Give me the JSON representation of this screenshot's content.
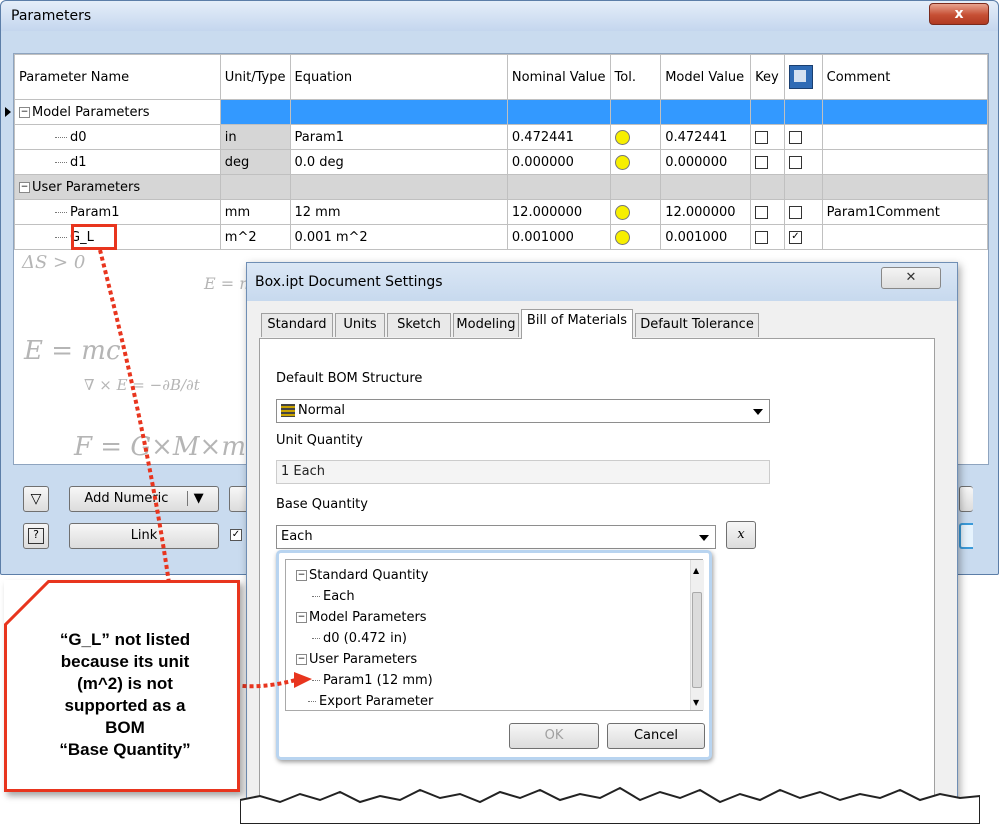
{
  "parameters_window": {
    "title": "Parameters",
    "close_glyph": "x",
    "columns": [
      "Parameter Name",
      "Unit/Type",
      "Equation",
      "Nominal Value",
      "Tol.",
      "Model Value",
      "Key",
      "",
      "Comment"
    ],
    "groups": {
      "model": "Model Parameters",
      "user": "User Parameters"
    },
    "rows": [
      {
        "name": "d0",
        "unit": "in",
        "equation": "Param1",
        "nominal": "0.472441",
        "model": "0.472441",
        "key": "",
        "export": "",
        "comment": ""
      },
      {
        "name": "d1",
        "unit": "deg",
        "equation": "0.0 deg",
        "nominal": "0.000000",
        "model": "0.000000",
        "key": "",
        "export": "",
        "comment": ""
      },
      {
        "name": "Param1",
        "unit": "mm",
        "equation": "12 mm",
        "nominal": "12.000000",
        "model": "12.000000",
        "key": "",
        "export": "",
        "comment": "Param1Comment"
      },
      {
        "name": "G_L",
        "unit": "m^2",
        "equation": "0.001 m^2",
        "nominal": "0.001000",
        "model": "0.001000",
        "key": "",
        "export": "✓",
        "comment": ""
      }
    ],
    "buttons": {
      "add_numeric": "Add Numeric",
      "link": "Link",
      "help_glyph": "?"
    }
  },
  "settings_dialog": {
    "title": "Box.ipt Document Settings",
    "close_glyph": "✕",
    "tabs": [
      "Standard",
      "Units",
      "Sketch",
      "Modeling",
      "Bill of Materials",
      "Default Tolerance"
    ],
    "active_tab": "Bill of Materials",
    "default_bom_structure_label": "Default BOM Structure",
    "default_bom_structure_value": "Normal",
    "unit_quantity_label": "Unit Quantity",
    "unit_quantity_value": "1 Each",
    "base_quantity_label": "Base Quantity",
    "base_quantity_value": "Each",
    "base_quantity_button": "x",
    "dropdown": {
      "items": [
        {
          "label": "Standard Quantity",
          "level": 0,
          "expander": "−"
        },
        {
          "label": "Each",
          "level": 1
        },
        {
          "label": "Model Parameters",
          "level": 0,
          "expander": "−"
        },
        {
          "label": "d0 (0.472 in)",
          "level": 1
        },
        {
          "label": "User Parameters",
          "level": 0,
          "expander": "−"
        },
        {
          "label": "Param1 (12 mm)",
          "level": 1
        },
        {
          "label": "Export Parameter",
          "level": 0
        }
      ],
      "ok": "OK",
      "cancel": "Cancel"
    }
  },
  "callout": {
    "lines": [
      "“G_L” not listed",
      "because its unit",
      "(m^2) is not",
      "supported as a",
      "BOM",
      "“Base Quantity”"
    ]
  },
  "colors": {
    "accent_red": "#e8351e",
    "selection_blue": "#3399ff",
    "tolerance_yellow": "#f7ef00"
  }
}
